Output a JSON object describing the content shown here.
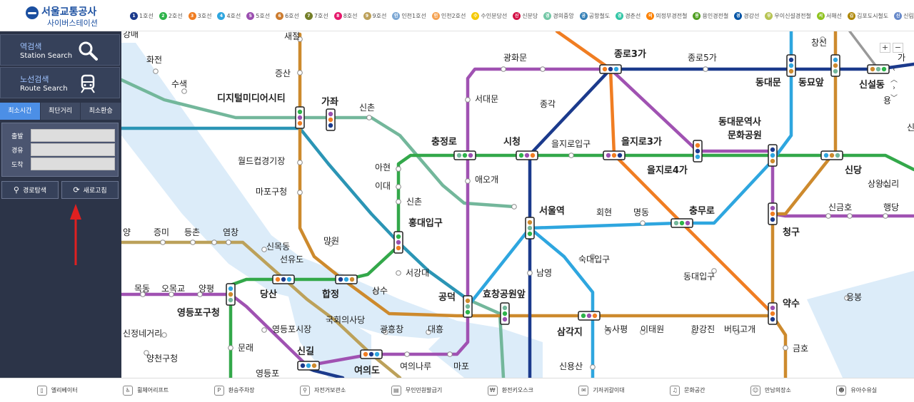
{
  "header": {
    "logo_name": "서울교통공사",
    "logo_sub": "사이버스테이션",
    "line_legend": [
      {
        "mark": "1",
        "label": "1호선",
        "color": "#1b3a8c"
      },
      {
        "mark": "2",
        "label": "2호선",
        "color": "#2db34a"
      },
      {
        "mark": "3",
        "label": "3호선",
        "color": "#f07d22"
      },
      {
        "mark": "4",
        "label": "4호선",
        "color": "#2ea6df"
      },
      {
        "mark": "5",
        "label": "5호선",
        "color": "#9b4fb0"
      },
      {
        "mark": "6",
        "label": "6호선",
        "color": "#cd7c2f"
      },
      {
        "mark": "7",
        "label": "7호선",
        "color": "#747f28"
      },
      {
        "mark": "8",
        "label": "8호선",
        "color": "#e6186c"
      },
      {
        "mark": "9",
        "label": "9호선",
        "color": "#bda15a"
      },
      {
        "mark": "인",
        "label": "인천1호선",
        "color": "#7ca8d5"
      },
      {
        "mark": "인",
        "label": "인천2호선",
        "color": "#f5a251"
      },
      {
        "mark": "수",
        "label": "수인분당선",
        "color": "#f5c900"
      },
      {
        "mark": "신",
        "label": "신분당",
        "color": "#d31145"
      },
      {
        "mark": "경",
        "label": "경의중앙",
        "color": "#73c7a6"
      },
      {
        "mark": "공",
        "label": "공항철도",
        "color": "#3681b7"
      },
      {
        "mark": "경",
        "label": "경춘선",
        "color": "#32c6a6"
      },
      {
        "mark": "의",
        "label": "의정부경전철",
        "color": "#fd8100"
      },
      {
        "mark": "용",
        "label": "용인경전철",
        "color": "#509f22"
      },
      {
        "mark": "경",
        "label": "경강선",
        "color": "#0054a6"
      },
      {
        "mark": "우",
        "label": "우이신설경전철",
        "color": "#b7c452"
      },
      {
        "mark": "서",
        "label": "서해선",
        "color": "#8fc31f"
      },
      {
        "mark": "김",
        "label": "김포도시철도",
        "color": "#ad8605"
      },
      {
        "mark": "신",
        "label": "신림선",
        "color": "#6789ca"
      }
    ]
  },
  "sidebar": {
    "station_search": {
      "kr": "역검색",
      "en": "Station Search"
    },
    "route_search": {
      "kr": "노선검색",
      "en": "Route Search"
    },
    "tabs": [
      "최소시간",
      "최단거리",
      "최소환승"
    ],
    "form": [
      {
        "label": "출발",
        "value": ""
      },
      {
        "label": "경유",
        "value": ""
      },
      {
        "label": "도착",
        "value": ""
      }
    ],
    "search_button": "경로탐색",
    "reset_button": "새로고침",
    "arrow_color": "#e02020"
  },
  "map": {
    "zoom_in": "+",
    "zoom_out": "−",
    "pan_up": "‹",
    "pan_down": "›",
    "stations": [
      {
        "id": "s1",
        "name": "강매"
      },
      {
        "id": "s2",
        "name": "새절"
      },
      {
        "id": "s3",
        "name": "화전"
      },
      {
        "id": "s4",
        "name": "수색"
      },
      {
        "id": "s5",
        "name": "증산"
      },
      {
        "id": "s6",
        "name": "디지털미디어시티"
      },
      {
        "id": "s7",
        "name": "가좌"
      },
      {
        "id": "s8",
        "name": "신촌"
      },
      {
        "id": "s9",
        "name": "광화문"
      },
      {
        "id": "s10",
        "name": "종로3가"
      },
      {
        "id": "s11",
        "name": "종로5가"
      },
      {
        "id": "s12",
        "name": "창신"
      },
      {
        "id": "s13",
        "name": "동대문"
      },
      {
        "id": "s14",
        "name": "동묘앞"
      },
      {
        "id": "s15",
        "name": "신설동"
      },
      {
        "id": "s16",
        "name": "서대문"
      },
      {
        "id": "s17",
        "name": "종각"
      },
      {
        "id": "s18",
        "name": "동대문역사"
      },
      {
        "id": "s19",
        "name": "문화공원"
      },
      {
        "id": "s20",
        "name": "충정로"
      },
      {
        "id": "s21",
        "name": "시청"
      },
      {
        "id": "s22",
        "name": "을지로입구"
      },
      {
        "id": "s23",
        "name": "을지로3가"
      },
      {
        "id": "s24",
        "name": "을지로4가"
      },
      {
        "id": "s25",
        "name": "월드컵경기장"
      },
      {
        "id": "s26",
        "name": "아현"
      },
      {
        "id": "s27",
        "name": "애오개"
      },
      {
        "id": "s28",
        "name": "신당"
      },
      {
        "id": "s29",
        "name": "상왕십리"
      },
      {
        "id": "s30",
        "name": "이대"
      },
      {
        "id": "s31",
        "name": "마포구청"
      },
      {
        "id": "s32",
        "name": "신촌"
      },
      {
        "id": "s33",
        "name": "서울역"
      },
      {
        "id": "s34",
        "name": "홍대입구"
      },
      {
        "id": "s35",
        "name": "회현"
      },
      {
        "id": "s36",
        "name": "명동"
      },
      {
        "id": "s37",
        "name": "충무로"
      },
      {
        "id": "s38",
        "name": "신금호"
      },
      {
        "id": "s39",
        "name": "행당"
      },
      {
        "id": "s40",
        "name": "양"
      },
      {
        "id": "s41",
        "name": "증미"
      },
      {
        "id": "s42",
        "name": "등촌"
      },
      {
        "id": "s43",
        "name": "염창"
      },
      {
        "id": "s44",
        "name": "망원"
      },
      {
        "id": "s45",
        "name": "청구"
      },
      {
        "id": "s46",
        "name": "신목동"
      },
      {
        "id": "s47",
        "name": "선유도"
      },
      {
        "id": "s48",
        "name": "숙대입구"
      },
      {
        "id": "s49",
        "name": "남영"
      },
      {
        "id": "s50",
        "name": "서강대"
      },
      {
        "id": "s51",
        "name": "동대입구"
      },
      {
        "id": "s52",
        "name": "목동"
      },
      {
        "id": "s53",
        "name": "오목교"
      },
      {
        "id": "s54",
        "name": "양평"
      },
      {
        "id": "s55",
        "name": "당산"
      },
      {
        "id": "s56",
        "name": "합정"
      },
      {
        "id": "s57",
        "name": "상수"
      },
      {
        "id": "s58",
        "name": "공덕"
      },
      {
        "id": "s59",
        "name": "효창공원앞"
      },
      {
        "id": "s60",
        "name": "응봉"
      },
      {
        "id": "s61",
        "name": "영등포구청"
      },
      {
        "id": "s62",
        "name": "국회의사당"
      },
      {
        "id": "s63",
        "name": "약수"
      },
      {
        "id": "s64",
        "name": "신정네거리"
      },
      {
        "id": "s65",
        "name": "영등포시장"
      },
      {
        "id": "s66",
        "name": "광흥창"
      },
      {
        "id": "s67",
        "name": "대흥"
      },
      {
        "id": "s68",
        "name": "삼각지"
      },
      {
        "id": "s69",
        "name": "녹사평"
      },
      {
        "id": "s70",
        "name": "이태원"
      },
      {
        "id": "s71",
        "name": "한강진"
      },
      {
        "id": "s72",
        "name": "버티고개"
      },
      {
        "id": "s73",
        "name": "문래"
      },
      {
        "id": "s74",
        "name": "금호"
      },
      {
        "id": "s75",
        "name": "양천구청"
      },
      {
        "id": "s76",
        "name": "신길"
      },
      {
        "id": "s77",
        "name": "여의나루"
      },
      {
        "id": "s78",
        "name": "마포"
      },
      {
        "id": "s79",
        "name": "신용산"
      },
      {
        "id": "s80",
        "name": "여의도"
      },
      {
        "id": "s81",
        "name": "영등포"
      },
      {
        "id": "s82",
        "name": "용"
      },
      {
        "id": "s83",
        "name": "가"
      },
      {
        "id": "s84",
        "name": "신"
      }
    ]
  },
  "bottom": [
    {
      "icon": "elevator-icon",
      "glyph": "▯",
      "label": "엘리베이터"
    },
    {
      "icon": "wheelchair-lift-icon",
      "glyph": "♿",
      "label": "휠체어리프트"
    },
    {
      "icon": "parking-icon",
      "glyph": "P",
      "label": "환승주차장"
    },
    {
      "icon": "bicycle-icon",
      "glyph": "⚲",
      "label": "자전거보관소"
    },
    {
      "icon": "id-machine-icon",
      "glyph": "▤",
      "label": "무인민원발급기"
    },
    {
      "icon": "currency-exchange-icon",
      "glyph": "₩",
      "label": "환전키오스크"
    },
    {
      "icon": "nursing-room-icon",
      "glyph": "✉",
      "label": "기저귀갈이대"
    },
    {
      "icon": "culture-space-icon",
      "glyph": "♫",
      "label": "문화공간"
    },
    {
      "icon": "meeting-place-icon",
      "glyph": "☺",
      "label": "만남의장소"
    },
    {
      "icon": "nursing-icon",
      "glyph": "☻",
      "label": "유아수유실"
    }
  ]
}
